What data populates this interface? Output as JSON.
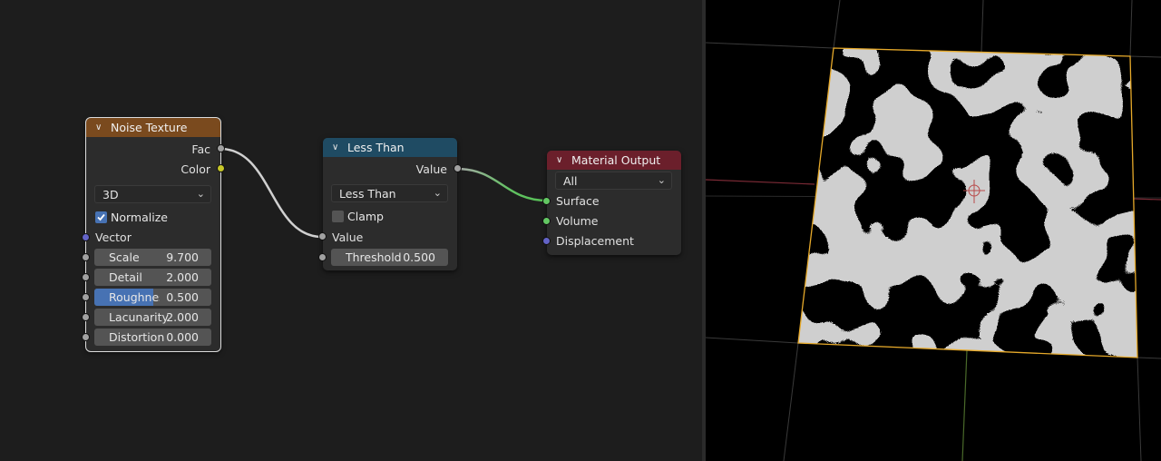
{
  "colors": {
    "noise_header": "#7a4a1e",
    "less_than_header": "#1f4b63",
    "output_header": "#6b1f2b",
    "socket_float": "#a1a1a1",
    "socket_color": "#c7c729",
    "socket_vector": "#6363c7",
    "socket_shader": "#63c763",
    "link_default": "#cfcfcf",
    "link_shader": "#62c262",
    "field_active": "#4772b3"
  },
  "noise": {
    "title": "Noise Texture",
    "out_fac": "Fac",
    "out_color": "Color",
    "dimensions": "3D",
    "normalize_label": "Normalize",
    "normalize_checked": true,
    "vector_label": "Vector",
    "scale_label": "Scale",
    "scale_value": "9.700",
    "detail_label": "Detail",
    "detail_value": "2.000",
    "roughness_label": "Roughnes",
    "roughness_value": "0.500",
    "roughness_fraction": 0.5,
    "lacunarity_label": "Lacunarity",
    "lacunarity_value": "2.000",
    "distortion_label": "Distortion",
    "distortion_value": "0.000"
  },
  "lessthan": {
    "title": "Less Than",
    "out_value": "Value",
    "operation": "Less Than",
    "clamp_label": "Clamp",
    "clamp_checked": false,
    "in_value": "Value",
    "threshold_label": "Threshold",
    "threshold_value": "0.500"
  },
  "output": {
    "title": "Material Output",
    "target": "All",
    "surface": "Surface",
    "volume": "Volume",
    "displacement": "Displacement"
  }
}
